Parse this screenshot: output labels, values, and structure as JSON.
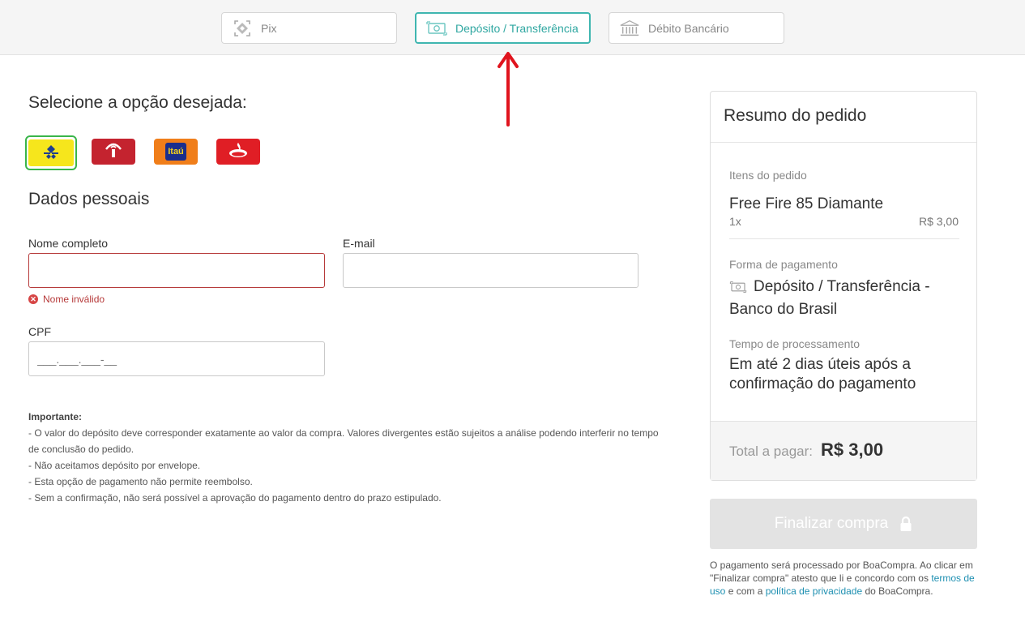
{
  "tabs": [
    {
      "label": "Pix",
      "icon": "pix-icon",
      "active": false
    },
    {
      "label": "Depósito / Transferência",
      "icon": "banknote-icon",
      "active": true
    },
    {
      "label": "Débito Bancário",
      "icon": "bank-building-icon",
      "active": false
    }
  ],
  "main": {
    "select_heading": "Selecione a opção desejada:",
    "banks": [
      {
        "name": "Banco do Brasil",
        "icon": "banco-do-brasil-logo",
        "selected": true
      },
      {
        "name": "Bradesco",
        "icon": "bradesco-logo",
        "selected": false
      },
      {
        "name": "Itaú",
        "icon": "itau-logo",
        "label": "Itaú",
        "selected": false
      },
      {
        "name": "Santander",
        "icon": "santander-logo",
        "selected": false
      }
    ],
    "personal_heading": "Dados pessoais",
    "name_label": "Nome completo",
    "name_value": "",
    "name_error": "Nome inválido",
    "email_label": "E-mail",
    "email_value": "",
    "cpf_label": "CPF",
    "cpf_placeholder": "___.___.___-__",
    "important_title": "Importante:",
    "important_lines": [
      "- O valor do depósito deve corresponder exatamente ao valor da compra. Valores divergentes estão sujeitos a análise podendo interferir no tempo de conclusão do pedido.",
      "- Não aceitamos depósito por envelope.",
      "- Esta opção de pagamento não permite reembolso.",
      "- Sem a confirmação, não será possível a aprovação do pagamento dentro do prazo estipulado."
    ]
  },
  "summary": {
    "title": "Resumo do pedido",
    "items_label": "Itens do pedido",
    "item_name": "Free Fire 85 Diamante",
    "item_qty": "1x",
    "item_price": "R$ 3,00",
    "payment_label": "Forma de pagamento",
    "payment_value_line1": "Depósito / Transferência -",
    "payment_value_line2": "Banco do Brasil",
    "processing_label": "Tempo de processamento",
    "processing_line1": "Em até 2 dias úteis após a",
    "processing_line2": "confirmação do pagamento",
    "total_label": "Total a pagar:",
    "total_value": "R$ 3,00"
  },
  "finalize_button": "Finalizar compra",
  "disclaimer": {
    "text1": "O pagamento será processado por BoaCompra. Ao clicar em \"Finalizar compra\" atesto que li e concordo com os",
    "link1": "termos de uso",
    "text2": "e com a",
    "link2": "política de privacidade",
    "text3": "do BoaCompra."
  },
  "colors": {
    "accent": "#3fb6b0",
    "error": "#b63a3a",
    "arrow": "#e0141e",
    "link": "#1d8fb1"
  }
}
